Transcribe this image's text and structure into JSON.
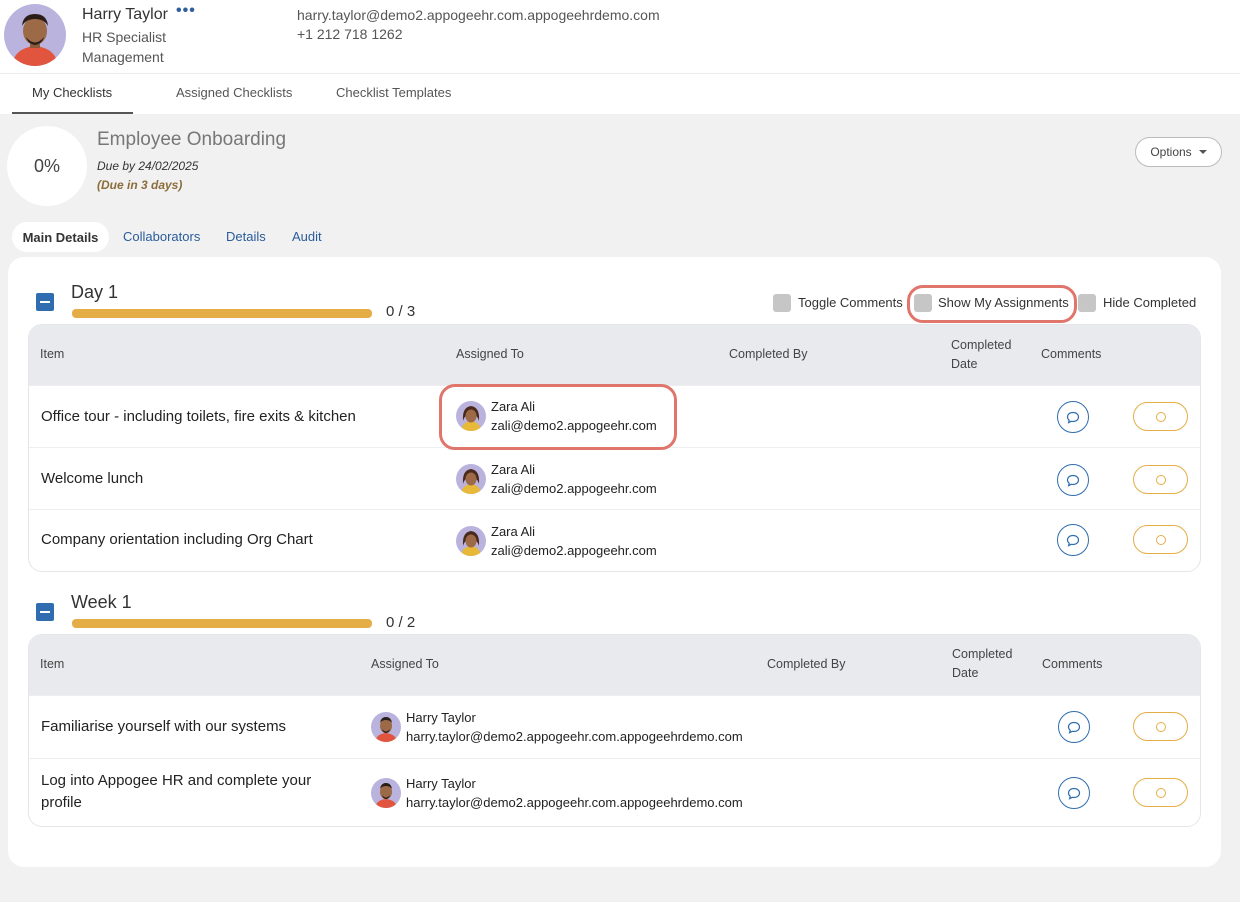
{
  "user": {
    "name": "Harry Taylor",
    "more_label": "•••",
    "role": "HR Specialist",
    "department": "Management",
    "email": "harry.taylor@demo2.appogeehr.com.appogeehrdemo.com",
    "phone": "+1 212 718 1262"
  },
  "tabs": [
    {
      "label": "My Checklists",
      "active": true
    },
    {
      "label": "Assigned Checklists",
      "active": false
    },
    {
      "label": "Checklist Templates",
      "active": false
    }
  ],
  "checklist": {
    "percent": "0%",
    "title": "Employee Onboarding",
    "due": "Due by 24/02/2025",
    "due_in": "(Due in 3 days)",
    "options_label": "Options"
  },
  "subtabs": [
    {
      "label": "Main Details",
      "active": true
    },
    {
      "label": "Collaborators",
      "active": false
    },
    {
      "label": "Details",
      "active": false
    },
    {
      "label": "Audit",
      "active": false
    }
  ],
  "filters": {
    "toggle_comments": "Toggle Comments",
    "show_my_assignments": "Show My Assignments",
    "hide_completed": "Hide Completed"
  },
  "sections": [
    {
      "title": "Day 1",
      "count": "0 / 3",
      "progress": 0,
      "headers": {
        "item": "Item",
        "assigned": "Assigned To",
        "completed_by": "Completed By",
        "completed_date_1": "Completed",
        "completed_date_2": "Date",
        "comments": "Comments"
      },
      "rows": [
        {
          "item": "Office tour - including toilets, fire exits & kitchen",
          "assignee": "Zara Ali",
          "email": "zali@demo2.appogeehr.com"
        },
        {
          "item": "Welcome lunch",
          "assignee": "Zara Ali",
          "email": "zali@demo2.appogeehr.com"
        },
        {
          "item": "Company orientation including Org Chart",
          "assignee": "Zara Ali",
          "email": "zali@demo2.appogeehr.com"
        }
      ]
    },
    {
      "title": "Week 1",
      "count": "0 / 2",
      "progress": 0,
      "headers": {
        "item": "Item",
        "assigned": "Assigned To",
        "completed_by": "Completed By",
        "completed_date_1": "Completed",
        "completed_date_2": "Date",
        "comments": "Comments"
      },
      "rows": [
        {
          "item": "Familiarise yourself with our systems",
          "assignee": "Harry Taylor",
          "email": "harry.taylor@demo2.appogeehr.com.appogeehrdemo.com"
        },
        {
          "item": "Log into Appogee HR and complete your profile",
          "assignee": "Harry Taylor",
          "email": "harry.taylor@demo2.appogeehr.com.appogeehrdemo.com"
        }
      ]
    }
  ],
  "colors": {
    "accent_blue": "#2f6db0",
    "progress_gold": "#e5ad46",
    "highlight": "#e0756c"
  },
  "icons": [
    "more-icon",
    "caret-down-icon",
    "collapse-icon",
    "comment-icon",
    "circle-icon",
    "avatar"
  ]
}
